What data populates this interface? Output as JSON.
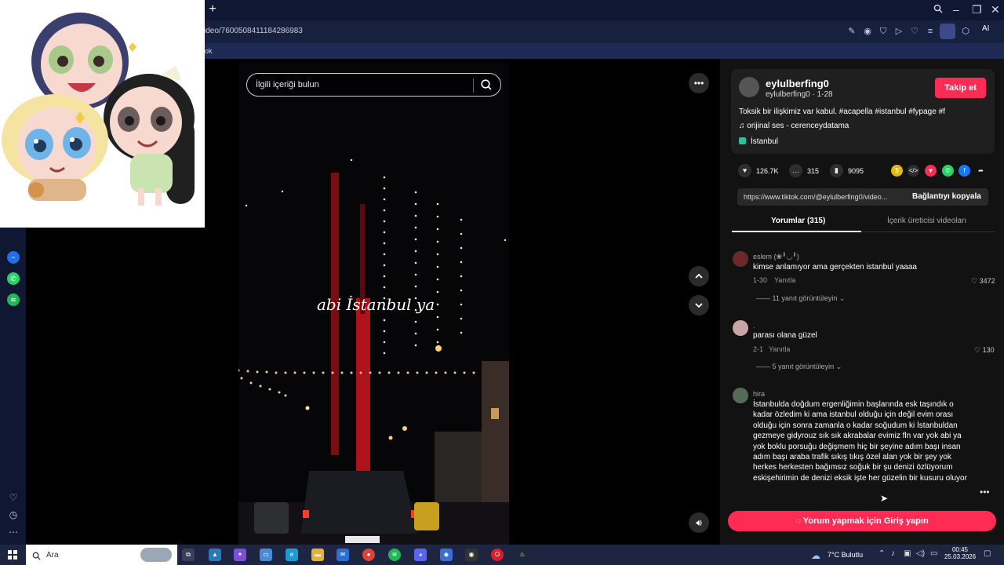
{
  "browser": {
    "url": "ideo/7600508411184286983",
    "bookmark_fragment": "ok",
    "ai_label": "AI"
  },
  "video": {
    "search_placeholder": "İlgili içeriği bulun",
    "overlay_text": "abi İstanbul ya"
  },
  "creator": {
    "username": "eylulberfing0",
    "handle_date": "eylulberfing0 · 1-28",
    "follow_label": "Takip et",
    "description": "Toksik bir ilişkimiz var kabul. #acapella #istanbul #fypage #f",
    "sound": "orijinal ses - cerenceydatama",
    "location": "İstanbul"
  },
  "stats": {
    "likes": "126.7K",
    "comments": "315",
    "saves": "9095"
  },
  "link": {
    "url": "https://www.tiktok.com/@eylulberfing0/video...",
    "copy_label": "Bağlantıyı kopyala"
  },
  "tabs": {
    "comments": "Yorumlar (315)",
    "creator_videos": "İçerik üreticisi videoları"
  },
  "comments": [
    {
      "user": "eslem (❀╹◡╹)",
      "text": "kimse anlamıyor ama gerçekten istanbul yaaaa",
      "date": "1-30",
      "reply": "Yanıtla",
      "likes": "3472",
      "more": "11 yanıt görüntüleyin"
    },
    {
      "user": ".",
      "text": "parası olana güzel",
      "date": "2-1",
      "reply": "Yanıtla",
      "likes": "130",
      "more": "5 yanıt görüntüleyin"
    },
    {
      "user": "hira",
      "text": "İstanbulda doğdum ergenliğimin başlarında esk taşındık o kadar özledim ki ama istanbul olduğu için değil evim orası olduğu için sonra zamanla o kadar soğudum ki İstanbuldan gezmeye gidyrouz sık sık akrabalar evimiz fln var yok abi ya yok boklu porsuğu değişmem hiç bir şeyine adım başı insan adım başı araba trafik sıkış tıkış özel alan yok bir şey yok herkes herkesten bağımsız soğuk bir şu denizi özlüyorum eskişehirimin de denizi eksik işte her güzelin bir kusuru oluyor"
    }
  ],
  "login_prompt": "Yorum yapmak için Giriş yapın",
  "taskbar": {
    "search_placeholder": "Ara",
    "weather": "7°C  Bulutlu",
    "time": "00:45",
    "date": "25.03.2026"
  },
  "colors": {
    "accent": "#fe2c55",
    "panel": "#121212",
    "chrome": "#0f1733"
  }
}
